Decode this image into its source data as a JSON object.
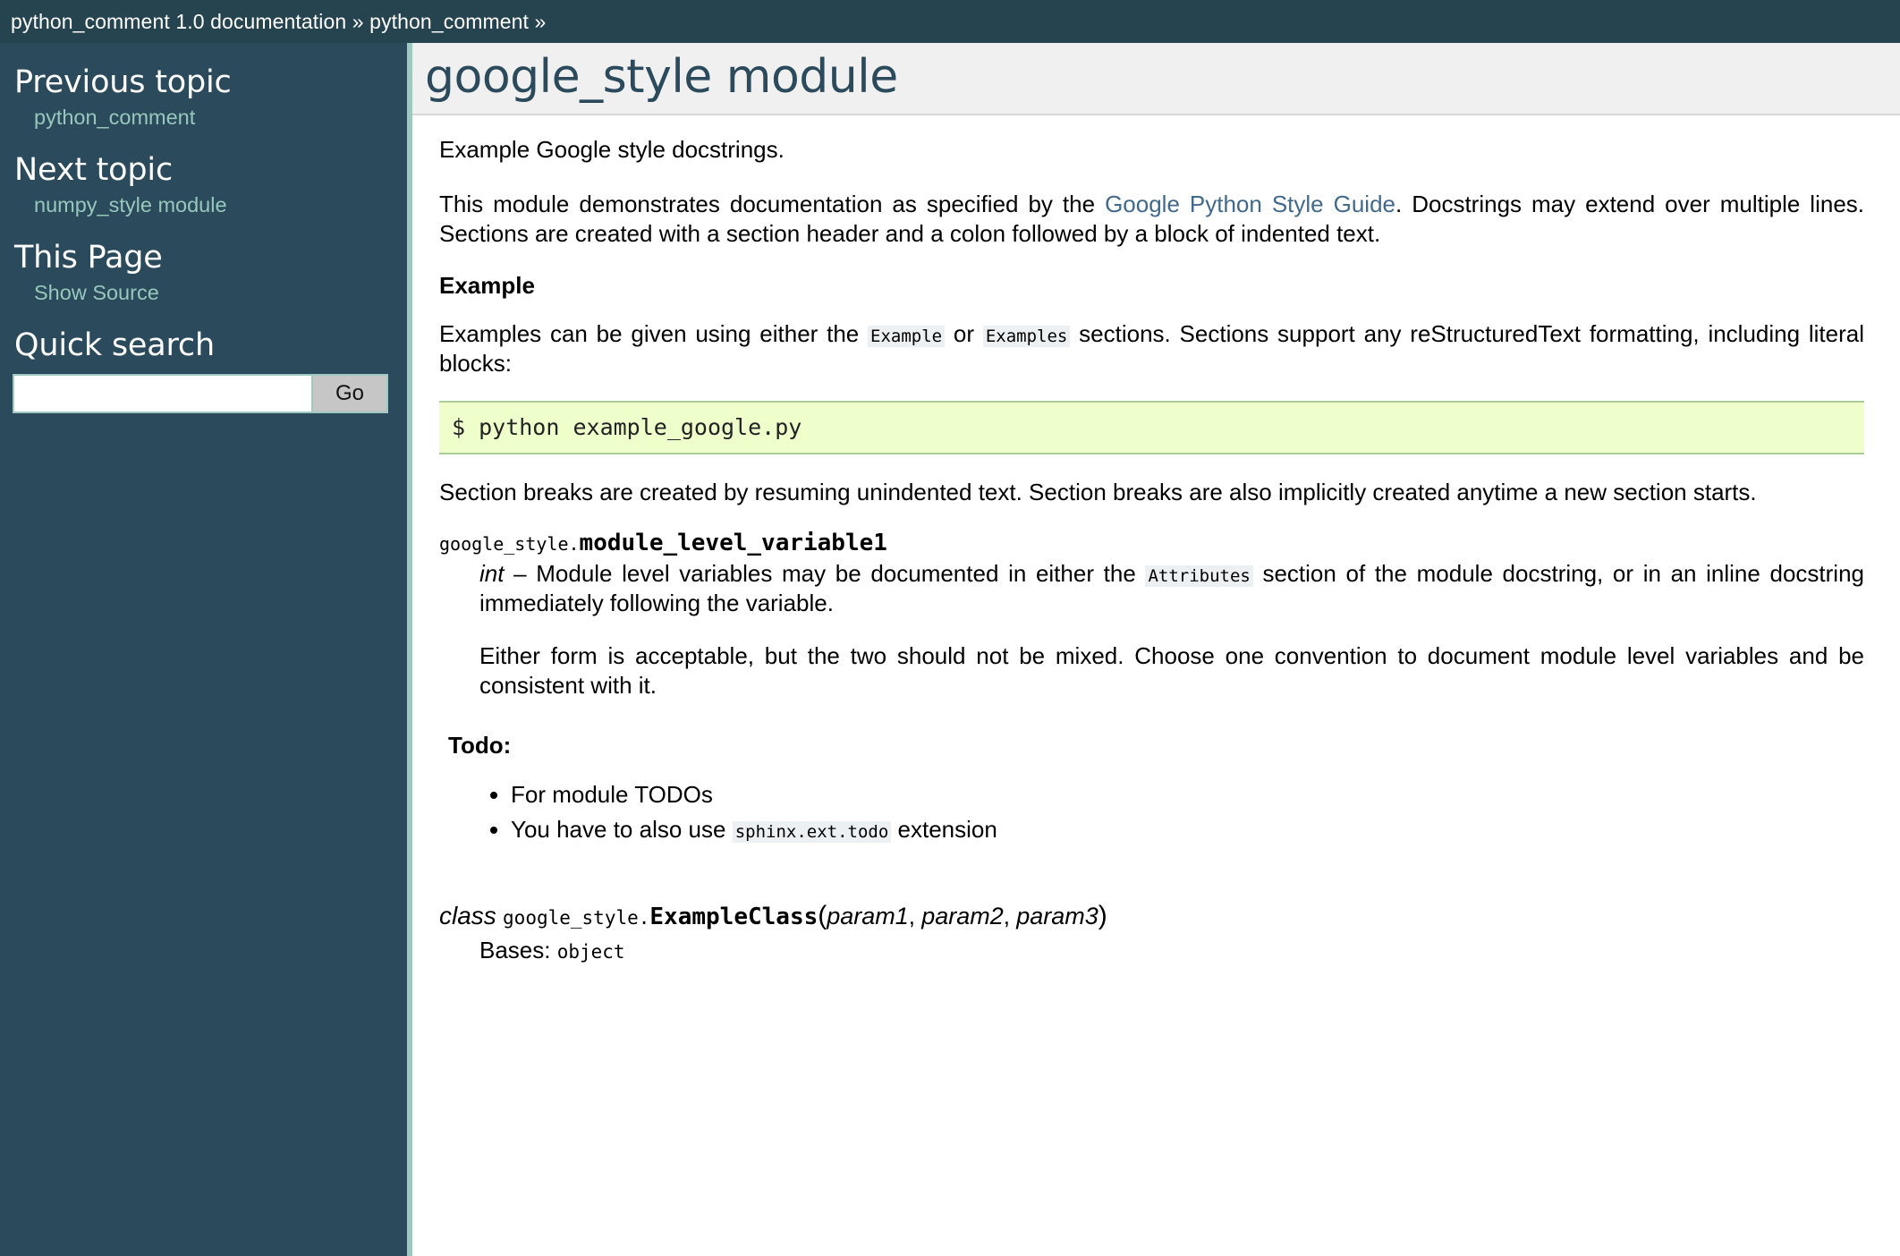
{
  "related_bar": {
    "documentation_crumb": "python_comment 1.0 documentation",
    "separator_1": "»",
    "module_crumb": "python_comment",
    "separator_2": "»"
  },
  "sidebar": {
    "sections": [
      {
        "heading": "Previous topic",
        "link_text": "python_comment"
      },
      {
        "heading": "Next topic",
        "link_text": "numpy_style module"
      },
      {
        "heading": "This Page",
        "link_text": "Show Source"
      }
    ],
    "quick_search": {
      "heading": "Quick search",
      "input_value": "",
      "input_placeholder": "",
      "go_label": "Go"
    }
  },
  "content": {
    "title": "google_style module",
    "intro_paragraph": "Example Google style docstrings.",
    "module_paragraph": {
      "before_link": "This module demonstrates documentation as specified by the ",
      "link_text": "Google Python Style Guide",
      "after_link": ". Docstrings may extend over multiple lines. Sections are created with a section header and a colon followed by a block of indented text."
    },
    "example_rubric": "Example",
    "examples_paragraph": {
      "part1": "Examples can be given using either the ",
      "code1": "Example",
      "part2": " or ",
      "code2": "Examples",
      "part3": " sections. Sections support any reStructuredText formatting, including literal blocks:"
    },
    "code_block": "$ python example_google.py",
    "section_breaks_paragraph": "Section breaks are created by resuming unindented text. Section breaks are also implicitly created anytime a new section starts.",
    "module_variable": {
      "prefix": "google_style.",
      "name": "module_level_variable1",
      "type": "int",
      "dash": " – ",
      "desc_part1": "Module level variables may be documented in either the ",
      "desc_code": "Attributes",
      "desc_part2": " section of the module docstring, or in an inline docstring immediately following the variable.",
      "desc_paragraph2": "Either form is acceptable, but the two should not be mixed. Choose one convention to document module level variables and be consistent with it."
    },
    "todo": {
      "title": "Todo:",
      "items": [
        {
          "text_before": "For module TODOs",
          "code": "",
          "text_after": ""
        },
        {
          "text_before": "You have to also use ",
          "code": "sphinx.ext.todo",
          "text_after": " extension"
        }
      ]
    },
    "example_class": {
      "keyword": "class",
      "prefix": "google_style.",
      "name": "ExampleClass",
      "open_paren": "(",
      "params": [
        "param1",
        "param2",
        "param3"
      ],
      "param_sep": ", ",
      "close_paren": ")",
      "bases_label": "Bases: ",
      "bases_value": "object"
    }
  },
  "colors": {
    "sidebar_bg": "#2B4A5B",
    "related_bar_bg": "#25444F",
    "sidebar_link": "#98C8BD",
    "title_color": "#2B4A5B",
    "title_band_bg": "#F0F0F0",
    "external_link": "#41698C",
    "code_block_bg": "#EEFFCC",
    "code_block_border": "#AACC99",
    "inline_code_bg": "#ECF0F3",
    "content_border": "#9FC9C0"
  }
}
